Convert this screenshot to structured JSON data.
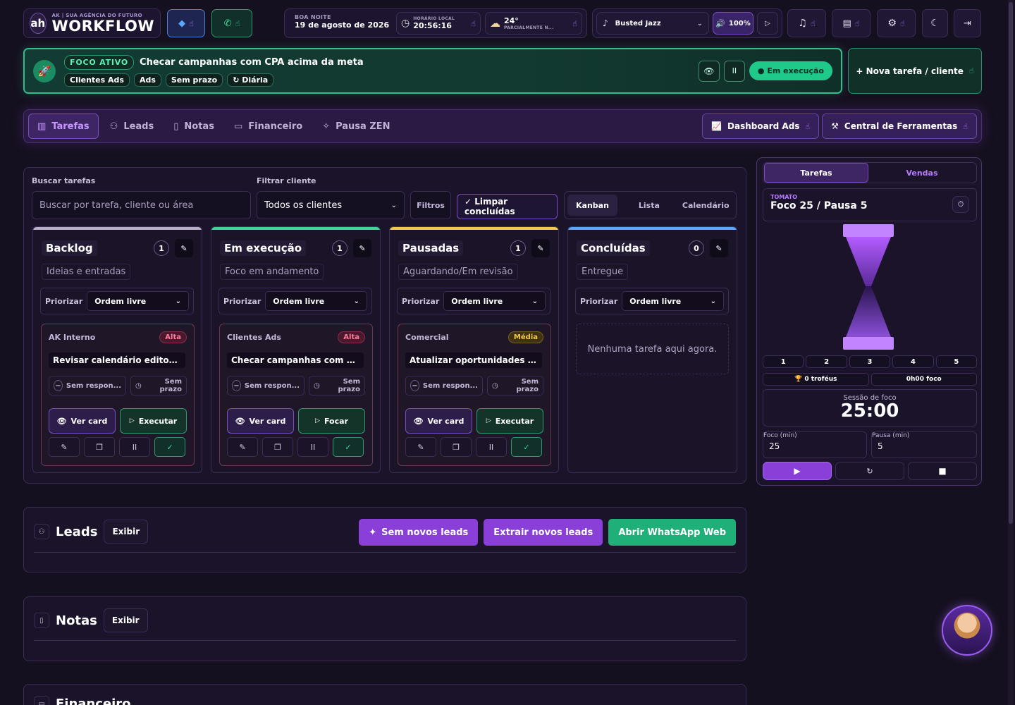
{
  "brand": {
    "subtitle": "AK | SUA AGÊNCIA DO FUTURO",
    "title": "WORKFLOW",
    "logo": "ah"
  },
  "topbar": {
    "greeting_label": "BOA NOITE",
    "date": "19 de agosto de 2026",
    "time_label": "HORÁRIO LOCAL",
    "time": "20:56:16",
    "weather_temp": "24°",
    "weather_desc": "PARCIALMENTE N...",
    "music_track": "Busted Jazz",
    "volume": "100%"
  },
  "focus": {
    "label": "FOCO ATIVO",
    "task": "Checar campanhas com CPA acima da meta",
    "tags": [
      "Clientes Ads",
      "Ads",
      "Sem prazo",
      "↻ Diária"
    ],
    "status": "Em execução"
  },
  "new_task_label": "+ Nova tarefa / cliente",
  "nav": {
    "items": [
      "Tarefas",
      "Leads",
      "Notas",
      "Financeiro",
      "Pausa ZEN"
    ],
    "buttons": [
      "Dashboard Ads",
      "Central de Ferramentas"
    ]
  },
  "filters": {
    "search_label": "Buscar tarefas",
    "search_placeholder": "Buscar por tarefa, cliente ou área",
    "client_label": "Filtrar cliente",
    "client_value": "Todos os clientes",
    "filters_btn": "Filtros",
    "clear_btn": "✓ Limpar concluídas",
    "views": [
      "Kanban",
      "Lista",
      "Calendário"
    ]
  },
  "columns": [
    {
      "name": "Backlog",
      "count": "1",
      "desc": "Ideias e entradas",
      "prio_label": "Priorizar",
      "prio_value": "Ordem livre",
      "color": "#b9b0c8",
      "card": {
        "client": "AK Interno",
        "badge": "Alta",
        "title": "Revisar calendário editori...",
        "resp": "Sem respon...",
        "due": "Sem prazo",
        "view": "Ver card",
        "action": "Executar"
      }
    },
    {
      "name": "Em execução",
      "count": "1",
      "desc": "Foco em andamento",
      "prio_label": "Priorizar",
      "prio_value": "Ordem livre",
      "color": "#3fd69a",
      "card": {
        "client": "Clientes Ads",
        "badge": "Alta",
        "title": "Checar campanhas com C...",
        "resp": "Sem respon...",
        "due": "Sem prazo",
        "view": "Ver card",
        "action": "Focar"
      }
    },
    {
      "name": "Pausadas",
      "count": "1",
      "desc": "Aguardando/Em revisão",
      "prio_label": "Priorizar",
      "prio_value": "Ordem livre",
      "color": "#f2c94c",
      "card": {
        "client": "Comercial",
        "badge": "Média",
        "title": "Atualizar oportunidades n...",
        "resp": "Sem respon...",
        "due": "Sem prazo",
        "view": "Ver card",
        "action": "Executar"
      }
    },
    {
      "name": "Concluídas",
      "count": "0",
      "desc": "Entregue",
      "prio_label": "Priorizar",
      "prio_value": "Ordem livre",
      "color": "#5aa8ff",
      "empty": "Nenhuma tarefa aqui agora."
    }
  ],
  "leads": {
    "title": "Leads",
    "toggle": "Exibir",
    "b1": "Sem novos leads",
    "b2": "Extrair novos leads",
    "b3": "Abrir WhatsApp Web"
  },
  "notes": {
    "title": "Notas",
    "toggle": "Exibir"
  },
  "finance": {
    "title": "Financeiro"
  },
  "pomodoro": {
    "tabs": [
      "Tarefas",
      "Vendas"
    ],
    "tag": "TOMATO",
    "mode": "Foco 25 / Pausa 5",
    "cycles": [
      "1",
      "2",
      "3",
      "4",
      "5"
    ],
    "trophies": "🏆 0 troféus",
    "focus_time": "0h00 foco",
    "session_label": "Sessão de foco",
    "timer": "25:00",
    "focus_label": "Foco (min)",
    "focus_value": "25",
    "pause_label": "Pausa (min)",
    "pause_value": "5"
  }
}
